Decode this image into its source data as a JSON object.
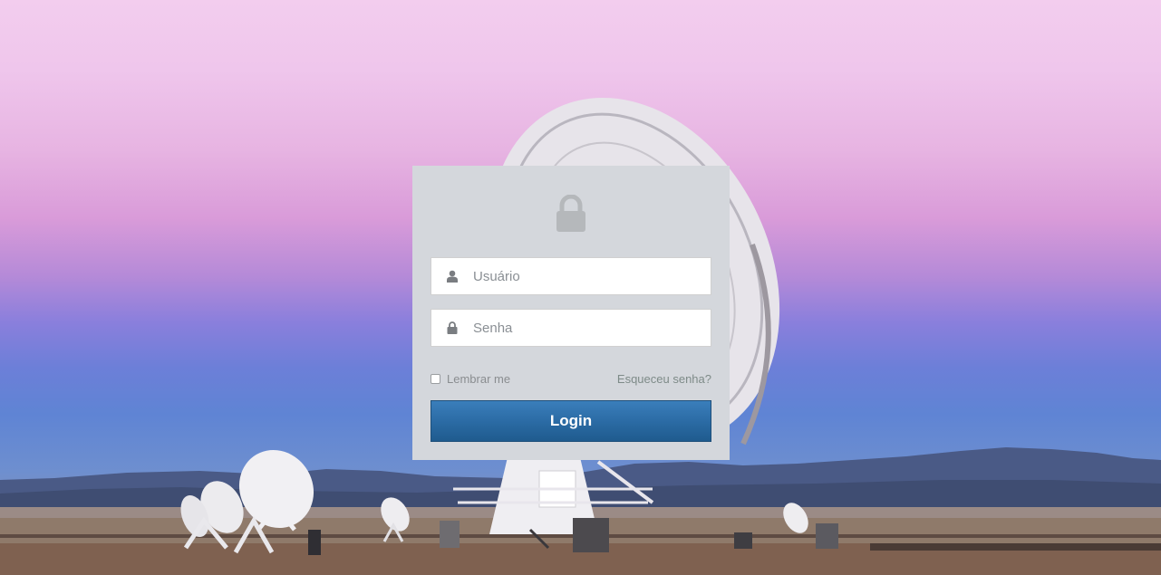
{
  "background": {
    "image": "radio-telescope-array-at-dusk",
    "sky_colors": [
      "#f3cdee",
      "#d99bd9",
      "#6c7fd8"
    ]
  },
  "login": {
    "lock_icon": "lock-icon",
    "username": {
      "icon": "user-icon",
      "placeholder": "Usuário",
      "value": ""
    },
    "password": {
      "icon": "lock-icon",
      "placeholder": "Senha",
      "value": ""
    },
    "remember_label": "Lembrar me",
    "remember_checked": false,
    "forgot_label": "Esqueceu senha?",
    "button_label": "Login",
    "button_color": "#2a6aa3",
    "panel_color": "#d4d7dc"
  }
}
